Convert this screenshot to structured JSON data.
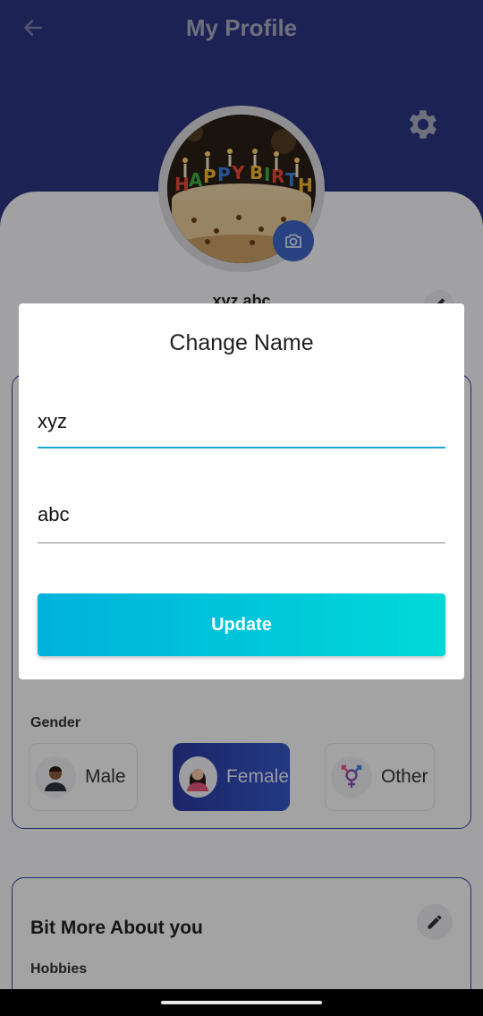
{
  "header": {
    "title": "My Profile",
    "back_icon": "arrow-left-icon",
    "settings_icon": "gear-icon"
  },
  "profile": {
    "name": "xyz abc",
    "camera_icon": "camera-icon",
    "edit_icon": "pencil-icon"
  },
  "gender": {
    "label": "Gender",
    "options": [
      {
        "label": "Male",
        "selected": false
      },
      {
        "label": "Female",
        "selected": true
      },
      {
        "label": "Other",
        "selected": false
      }
    ]
  },
  "about": {
    "title": "Bit More About you",
    "hobbies_label": "Hobbies"
  },
  "dialog": {
    "title": "Change Name",
    "first_name": "xyz",
    "last_name": "abc",
    "update_label": "Update"
  },
  "colors": {
    "header_bg": "#2c3581",
    "accent": "#00c4dc",
    "selected_gender": "#2b3a9e",
    "card_border": "#3b3f9e"
  }
}
